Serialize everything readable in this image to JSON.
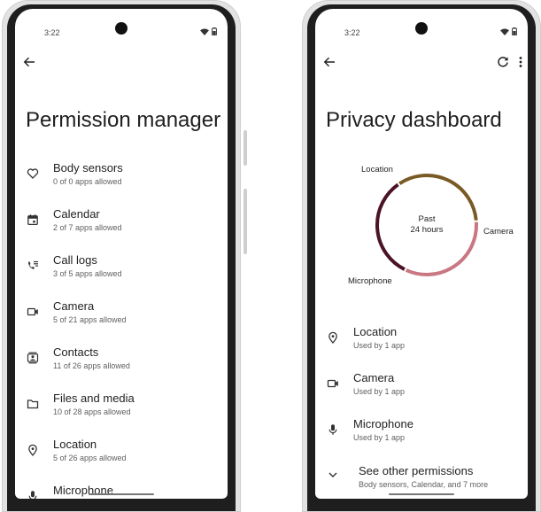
{
  "left_phone": {
    "status": {
      "time": "3:22"
    },
    "page_title": "Permission manager",
    "items": [
      {
        "icon": "heart-icon",
        "title": "Body sensors",
        "subtitle": "0 of 0 apps allowed"
      },
      {
        "icon": "calendar-icon",
        "title": "Calendar",
        "subtitle": "2 of 7 apps allowed"
      },
      {
        "icon": "call-log-icon",
        "title": "Call logs",
        "subtitle": "3 of 5 apps allowed"
      },
      {
        "icon": "videocam-icon",
        "title": "Camera",
        "subtitle": "5 of 21 apps allowed"
      },
      {
        "icon": "contacts-icon",
        "title": "Contacts",
        "subtitle": "11 of 26 apps allowed"
      },
      {
        "icon": "folder-icon",
        "title": "Files and media",
        "subtitle": "10 of 28 apps allowed"
      },
      {
        "icon": "location-pin-icon",
        "title": "Location",
        "subtitle": "5 of 26 apps allowed"
      },
      {
        "icon": "microphone-icon",
        "title": "Microphone",
        "subtitle": ""
      }
    ]
  },
  "right_phone": {
    "status": {
      "time": "3:22"
    },
    "page_title": "Privacy dashboard",
    "donut": {
      "center_line1": "Past",
      "center_line2": "24 hours",
      "segments": [
        {
          "label": "Location",
          "share": 0.3333,
          "color": "#7a5a24"
        },
        {
          "label": "Camera",
          "share": 0.3333,
          "color": "#c97883"
        },
        {
          "label": "Microphone",
          "share": 0.3333,
          "color": "#4a1426"
        }
      ]
    },
    "items": [
      {
        "icon": "location-pin-icon",
        "title": "Location",
        "subtitle": "Used by 1 app"
      },
      {
        "icon": "videocam-icon",
        "title": "Camera",
        "subtitle": "Used by 1 app"
      },
      {
        "icon": "microphone-icon",
        "title": "Microphone",
        "subtitle": "Used by 1 app"
      }
    ],
    "see_other": {
      "title": "See other permissions",
      "subtitle": "Body sensors, Calendar, and 7 more"
    }
  }
}
